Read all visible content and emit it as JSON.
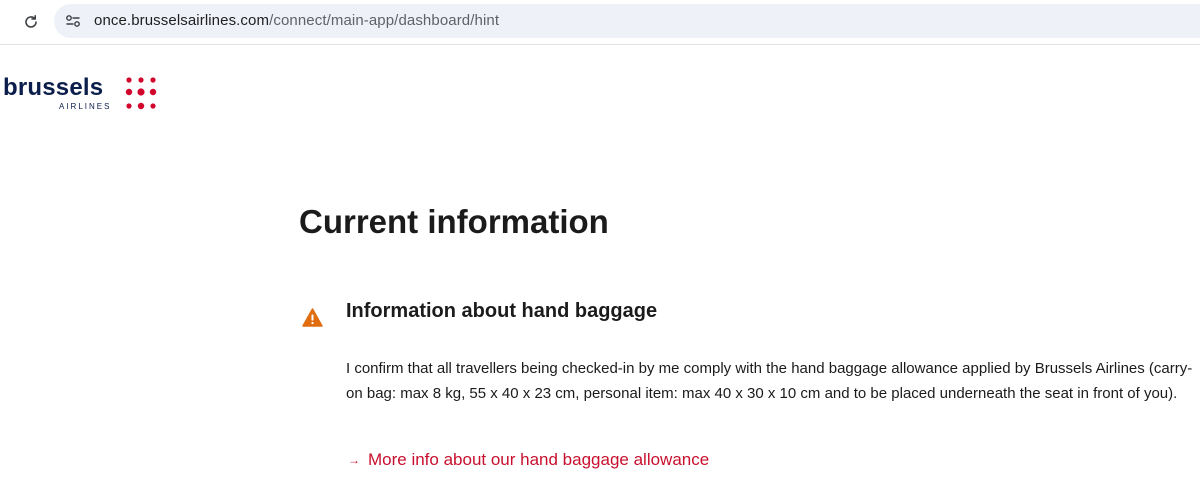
{
  "browser": {
    "url_domain": "once.brusselsairlines.com",
    "url_path": "/connect/main-app/dashboard/hint",
    "reload_icon": "reload-icon",
    "site_info_icon": "tune-icon"
  },
  "brand": {
    "wordmark": "brussels",
    "subtitle": "AIRLINES",
    "dot_color": "#d2052d",
    "navy_color": "#0b1d4a"
  },
  "main": {
    "title": "Current information",
    "notice": {
      "icon": "warning-icon",
      "icon_color": "#e06d0e",
      "title": "Information about hand baggage",
      "text": "I confirm that all travellers being checked-in by me comply with the hand baggage allowance applied by Brussels Airlines (carry-on bag: max 8 kg, 55 x 40 x 23 cm, personal item: max 40 x 30 x 10 cm and to be placed underneath the seat in front of you).",
      "link_arrow": "→",
      "link_label": "More info about our hand baggage allowance",
      "link_color": "#c8102e"
    }
  }
}
